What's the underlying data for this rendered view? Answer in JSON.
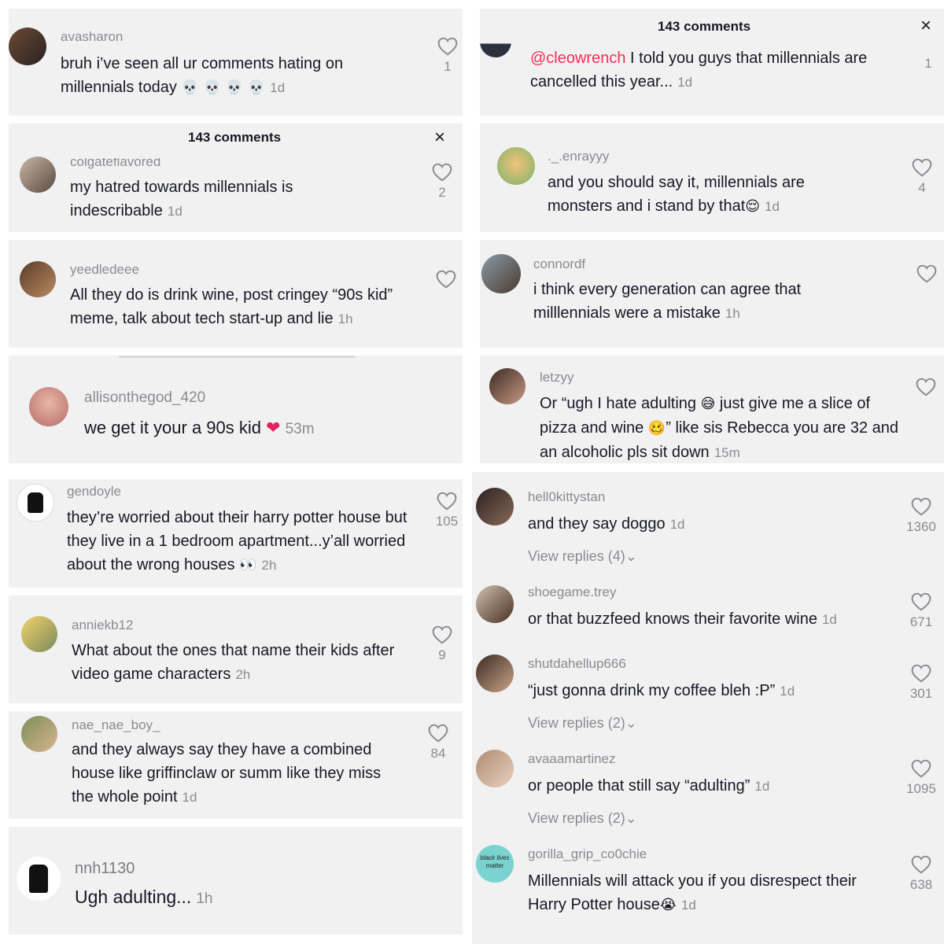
{
  "colors": {
    "panel_bg": "#f1f1f2",
    "text": "#161823",
    "muted": "#8a8b91",
    "mention": "#fe2c55",
    "heart_emoji": "#e0245e"
  },
  "left": {
    "c1": {
      "user": "avasharon",
      "text": "bruh i’ve seen all ur comments hating on millennials today",
      "emoji": "💀 💀 💀 💀",
      "time": "1d",
      "likes": "1"
    },
    "c2": {
      "header": "143 comments",
      "close": "×",
      "user": "colgateflavored",
      "text": "my hatred towards millennials is indescribable",
      "time": "1d",
      "likes": "2"
    },
    "c3": {
      "user": "yeedledeee",
      "text": "All they do is drink wine, post cringey “90s kid” meme, talk about tech start-up and lie",
      "time": "1h"
    },
    "c4": {
      "user": "allisonthegod_420",
      "text": "we get it your a 90s kid",
      "emoji": "❤",
      "time": "53m"
    },
    "c5": {
      "user": "gendoyle",
      "text": "they’re worried about their harry potter house but they live in a 1 bedroom apartment...y’all worried about the wrong houses",
      "emoji": "👀",
      "time": "2h",
      "likes": "105"
    },
    "c6": {
      "user": "anniekb12",
      "text": "What about the ones that name their kids after video game characters",
      "time": "2h",
      "likes": "9"
    },
    "c7": {
      "user": "nae_nae_boy_",
      "text": "and they always say they have a combined house like griffinclaw or summ like they miss the whole point",
      "time": "1d",
      "likes": "84"
    },
    "c8": {
      "user": "nnh1130",
      "text": "Ugh adulting...",
      "time": "1h"
    }
  },
  "right": {
    "c1": {
      "header": "143 comments",
      "close": "×",
      "mention": "@cleowrench",
      "text": " I told you guys that millennials are cancelled this year...",
      "time": "1d",
      "likes": "1"
    },
    "c2": {
      "user": "._.enrayyy",
      "text": "and you should say it, millennials are monsters and i stand by that",
      "emoji": "😌",
      "time": "1d",
      "likes": "4"
    },
    "c3": {
      "user": "connordf",
      "text": "i think every generation can agree that milllennials were a mistake",
      "time": "1h"
    },
    "c4": {
      "user": "letzyy",
      "text_a": "Or “ugh I hate adulting",
      "emoji_a": "😅",
      "text_b": " just give me a slice of pizza and wine",
      "emoji_b": "🥴",
      "text_c": "” like sis Rebecca you are 32 and an alcoholic pls sit down",
      "time": "15m"
    },
    "c5": {
      "user": "hell0kittystan",
      "text": "and they say doggo",
      "time": "1d",
      "likes": "1360",
      "replies": "View replies (4)"
    },
    "c6": {
      "user": "shoegame.trey",
      "text": "or that buzzfeed knows their favorite wine",
      "time": "1d",
      "likes": "671"
    },
    "c7": {
      "user": "shutdahellup666",
      "text": "“just gonna drink my coffee bleh :P”",
      "time": "1d",
      "likes": "301",
      "replies": "View replies (2)"
    },
    "c8": {
      "user": "avaaamartinez",
      "text": "or people that still say “adulting”",
      "time": "1d",
      "likes": "1095",
      "replies": "View replies (2)"
    },
    "c9": {
      "user": "gorilla_grip_co0chie",
      "avatar_text": "black lives matter",
      "text": "Millennials will attack you if you disrespect their Harry Potter house",
      "emoji": "😭",
      "time": "1d",
      "likes": "638"
    }
  }
}
